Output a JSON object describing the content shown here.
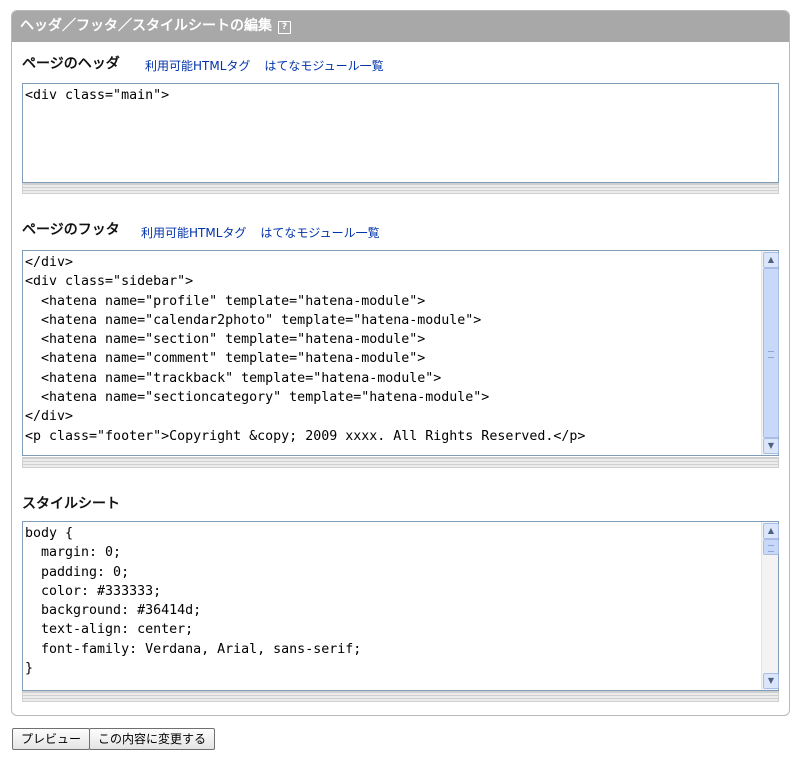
{
  "header": {
    "title": "ヘッダ／フッタ／スタイルシートの編集",
    "help_icon_glyph": "?"
  },
  "header_section": {
    "title": "ページのヘッダ",
    "links": [
      "利用可能HTMLタグ",
      "はてなモジュール一覧"
    ],
    "content": "<div class=\"main\">"
  },
  "footer_section": {
    "title": "ページのフッタ",
    "links": [
      "利用可能HTMLタグ",
      "はてなモジュール一覧"
    ],
    "content": "</div>\n<div class=\"sidebar\">\n  <hatena name=\"profile\" template=\"hatena-module\">\n  <hatena name=\"calendar2photo\" template=\"hatena-module\">\n  <hatena name=\"section\" template=\"hatena-module\">\n  <hatena name=\"comment\" template=\"hatena-module\">\n  <hatena name=\"trackback\" template=\"hatena-module\">\n  <hatena name=\"sectioncategory\" template=\"hatena-module\">\n</div>\n<p class=\"footer\">Copyright &copy; 2009 xxxx. All Rights Reserved.</p>"
  },
  "stylesheet_section": {
    "title": "スタイルシート",
    "content": "body {\n  margin: 0;\n  padding: 0;\n  color: #333333;\n  background: #36414d;\n  text-align: center;\n  font-family: Verdana, Arial, sans-serif;\n}"
  },
  "buttons": {
    "preview": "プレビュー",
    "apply": "この内容に変更する"
  },
  "colors": {
    "header_bar": "#a8a8a8",
    "link": "#0033aa",
    "scrollbar": "#c8d8f8"
  },
  "icons": {
    "help": "help-icon",
    "scroll_up": "arrow-up-icon",
    "scroll_down": "arrow-down-icon"
  }
}
